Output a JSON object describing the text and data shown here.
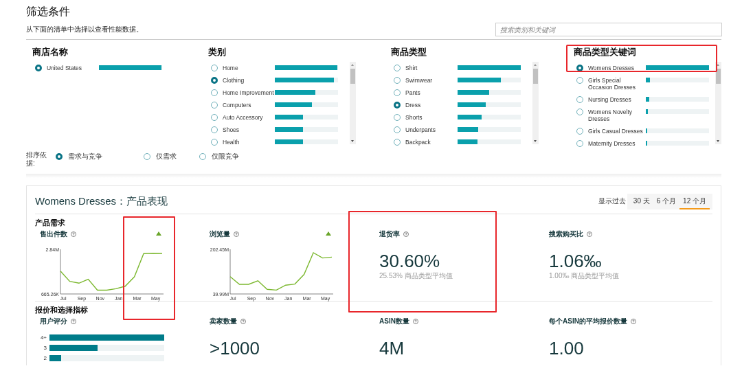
{
  "filter": {
    "title": "筛选条件",
    "subtitle": "从下面的清单中选择以查看性能数据。",
    "search": {
      "placeholder": "搜索类别和关键词"
    },
    "columns": [
      {
        "title": "商店名称",
        "scrollable": false,
        "items": [
          {
            "label": "United States",
            "selected": true,
            "level": 0.99
          }
        ]
      },
      {
        "title": "类别",
        "scrollable": true,
        "items": [
          {
            "label": "Home",
            "selected": false,
            "level": 0.99
          },
          {
            "label": "Clothing",
            "selected": true,
            "level": 0.93
          },
          {
            "label": "Home Improvement",
            "selected": false,
            "level": 0.64
          },
          {
            "label": "Computers",
            "selected": false,
            "level": 0.59
          },
          {
            "label": "Auto Accessory",
            "selected": false,
            "level": 0.45
          },
          {
            "label": "Shoes",
            "selected": false,
            "level": 0.45
          },
          {
            "label": "Health",
            "selected": false,
            "level": 0.45
          }
        ]
      },
      {
        "title": "商品类型",
        "scrollable": true,
        "items": [
          {
            "label": "Shirt",
            "selected": false,
            "level": 1
          },
          {
            "label": "Swimwear",
            "selected": false,
            "level": 0.68
          },
          {
            "label": "Pants",
            "selected": false,
            "level": 0.5
          },
          {
            "label": "Dress",
            "selected": true,
            "level": 0.45
          },
          {
            "label": "Shorts",
            "selected": false,
            "level": 0.38
          },
          {
            "label": "Underpants",
            "selected": false,
            "level": 0.33
          },
          {
            "label": "Backpack",
            "selected": false,
            "level": 0.32
          }
        ]
      },
      {
        "title": "商品类型关键词",
        "scrollable": true,
        "highlighted": true,
        "items": [
          {
            "label": "Womens Dresses",
            "selected": true,
            "level": 1
          },
          {
            "label": "Girls Special Occasion Dresses",
            "selected": false,
            "level": 0.07
          },
          {
            "label": "Nursing Dresses",
            "selected": false,
            "level": 0.05
          },
          {
            "label": "Womens Novelty Dresses",
            "selected": false,
            "level": 0.035
          },
          {
            "label": "Girls Casual Dresses",
            "selected": false,
            "level": 0.025
          },
          {
            "label": "Maternity Dresses",
            "selected": false,
            "level": 0.025
          }
        ]
      }
    ],
    "sort": {
      "label": "排序依据:",
      "options": [
        {
          "label": "需求与竞争",
          "selected": true
        },
        {
          "label": "仅需求",
          "selected": false
        },
        {
          "label": "仅限竞争",
          "selected": false
        }
      ]
    }
  },
  "performance": {
    "title": "Womens Dresses：产品表现",
    "range_label": "显示过去",
    "ranges": [
      {
        "label": "30 天",
        "selected": false
      },
      {
        "label": "6 个月",
        "selected": false
      },
      {
        "label": "12 个月",
        "selected": true
      }
    ],
    "sections": [
      {
        "title": "产品需求",
        "metrics": [
          {
            "kind": "chart",
            "label": "售出件数",
            "rising": true,
            "highlighted": true,
            "chart_data": {
              "type": "line",
              "categories": [
                "Jul",
                null,
                "Sep",
                null,
                "Nov",
                null,
                "Jan",
                null,
                "Mar",
                null,
                "May",
                null
              ],
              "ylim": [
                665260,
                2840000
              ],
              "yticks": [
                {
                  "value": 665260,
                  "label": "665.26K"
                },
                {
                  "value": 2840000,
                  "label": "2.84M"
                }
              ],
              "series": [
                {
                  "color": "#7cb82f",
                  "values": [
                    1780000,
                    1280000,
                    1190000,
                    1380000,
                    850000,
                    850000,
                    920000,
                    1040000,
                    1500000,
                    2630000,
                    2650000,
                    2640000
                  ]
                }
              ]
            }
          },
          {
            "kind": "chart",
            "label": "浏览量",
            "rising": true,
            "chart_data": {
              "type": "line",
              "categories": [
                "Jul",
                null,
                "Sep",
                null,
                "Nov",
                null,
                "Jan",
                null,
                "Mar",
                null,
                "May",
                null
              ],
              "ylim": [
                39990000,
                202450000
              ],
              "yticks": [
                {
                  "value": 39990000,
                  "label": "39.99M"
                },
                {
                  "value": 202450000,
                  "label": "202.45M"
                }
              ],
              "series": [
                {
                  "color": "#7cb82f",
                  "values": [
                    103000000,
                    75000000,
                    75000000,
                    88000000,
                    57000000,
                    54000000,
                    72000000,
                    76000000,
                    111000000,
                    190000000,
                    171000000,
                    174000000
                  ]
                }
              ]
            }
          },
          {
            "kind": "value",
            "label": "退货率",
            "value": "30.60%",
            "note": "25.53% 商品类型平均值",
            "highlighted": true
          },
          {
            "kind": "value",
            "label": "搜索购买比",
            "value": "1.06‰",
            "note": "1.00‰ 商品类型平均值"
          }
        ]
      },
      {
        "title": "报价和选择指标",
        "metrics": [
          {
            "kind": "bars",
            "label": "用户评分",
            "rows": [
              {
                "label": "4+",
                "level": 1
              },
              {
                "label": "3",
                "level": 0.42
              },
              {
                "label": "2",
                "level": 0.1
              }
            ]
          },
          {
            "kind": "value",
            "label": "卖家数量",
            "value": ">1000"
          },
          {
            "kind": "value",
            "label": "ASIN数量",
            "value": "4M"
          },
          {
            "kind": "value",
            "label": "每个ASIN的平均报价数量",
            "value": "1.00"
          }
        ]
      }
    ]
  }
}
